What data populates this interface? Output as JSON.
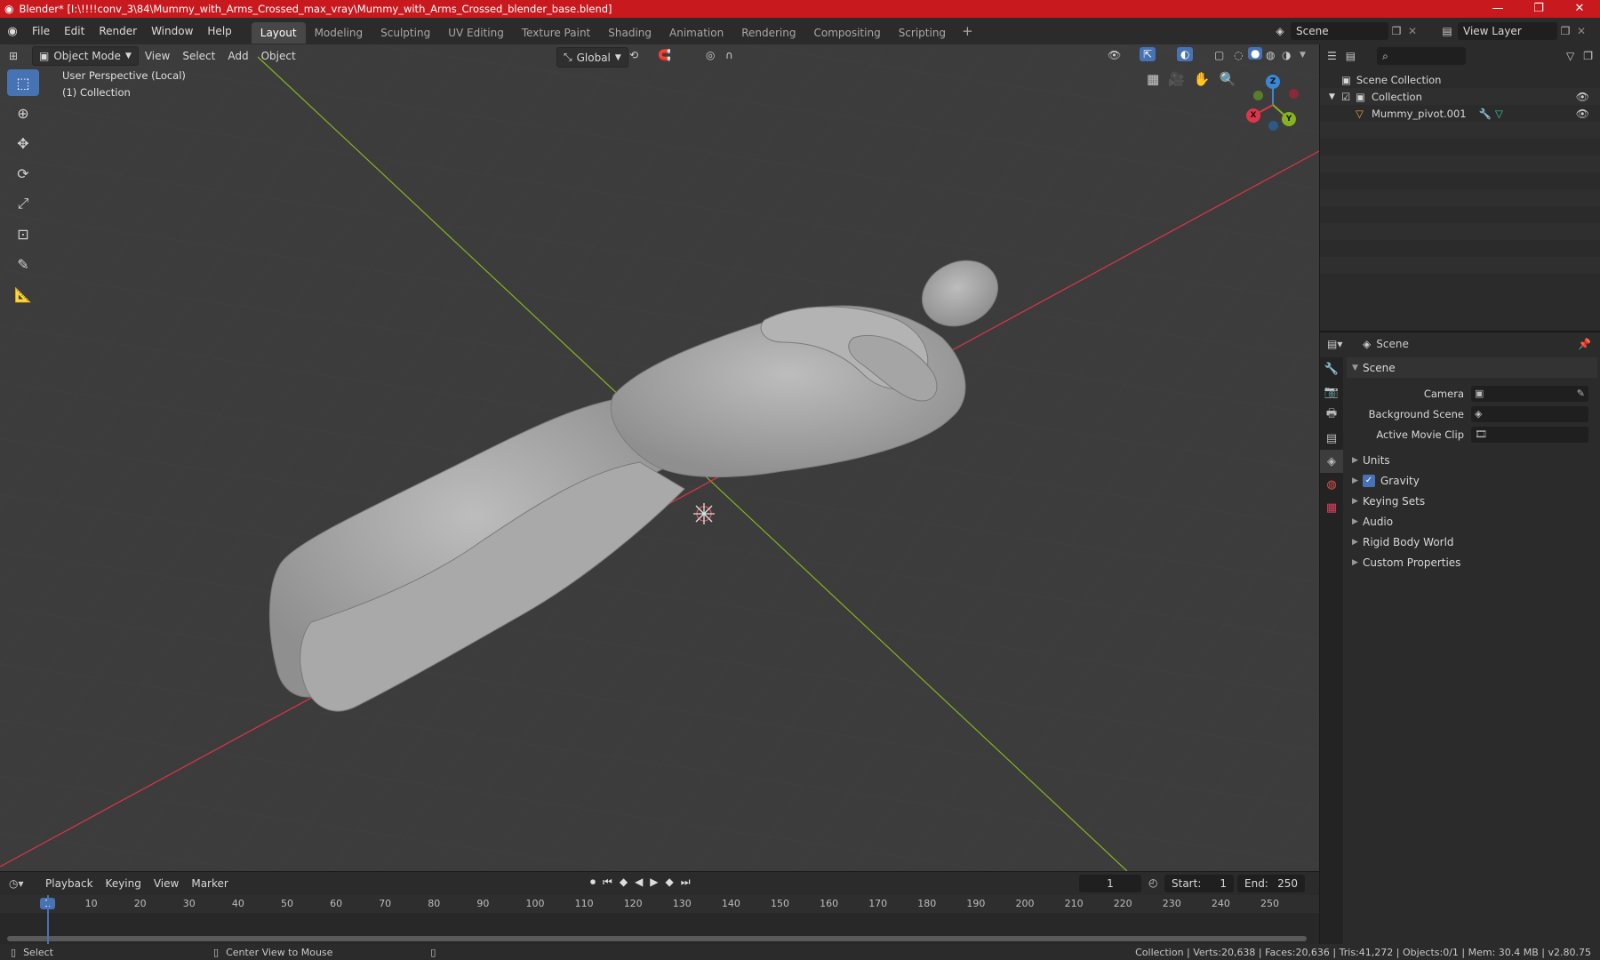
{
  "window": {
    "title": "Blender* [I:\\!!!!conv_3\\84\\Mummy_with_Arms_Crossed_max_vray\\Mummy_with_Arms_Crossed_blender_base.blend]",
    "minimize": "—",
    "maximize": "❐",
    "close": "✕"
  },
  "menu": [
    "File",
    "Edit",
    "Render",
    "Window",
    "Help"
  ],
  "workspaces": [
    "Layout",
    "Modeling",
    "Sculpting",
    "UV Editing",
    "Texture Paint",
    "Shading",
    "Animation",
    "Rendering",
    "Compositing",
    "Scripting"
  ],
  "add_workspace": "+",
  "scene_field": "Scene",
  "view_layer_field": "View Layer",
  "viewport": {
    "mode": "Object Mode",
    "menus": [
      "View",
      "Select",
      "Add",
      "Object"
    ],
    "transform_orientation": "Global",
    "overlay_line1": "User Perspective (Local)",
    "overlay_line2": "(1) Collection",
    "gizmo": {
      "x": "X",
      "y": "Y",
      "z": "Z"
    }
  },
  "outliner": {
    "root": "Scene Collection",
    "collection": "Collection",
    "object": "Mummy_pivot.001"
  },
  "properties": {
    "header": "Scene",
    "section": "Scene",
    "fields": [
      {
        "label": "Camera"
      },
      {
        "label": "Background Scene"
      },
      {
        "label": "Active Movie Clip"
      }
    ],
    "panels": [
      "Units",
      "Gravity",
      "Keying Sets",
      "Audio",
      "Rigid Body World",
      "Custom Properties"
    ]
  },
  "timeline": {
    "menus": [
      "Playback",
      "Keying",
      "View",
      "Marker"
    ],
    "current_frame": "1",
    "start_label": "Start:",
    "start": "1",
    "end_label": "End:",
    "end": "250",
    "ticks": [
      "1",
      "10",
      "20",
      "30",
      "40",
      "50",
      "60",
      "70",
      "80",
      "90",
      "100",
      "110",
      "120",
      "130",
      "140",
      "150",
      "160",
      "170",
      "180",
      "190",
      "200",
      "210",
      "220",
      "230",
      "240",
      "250"
    ]
  },
  "status": {
    "select": "Select",
    "center": "Center View to Mouse",
    "stats": "Collection | Verts:20,638 | Faces:20,636 | Tris:41,272 | Objects:0/1 | Mem: 30.4 MB | v2.80.75"
  },
  "colors": {
    "titlebar": "#c8191e",
    "accent": "#4772b3",
    "x_axis": "#e0344a",
    "y_axis": "#86b31f",
    "z_axis": "#3b87d6"
  }
}
